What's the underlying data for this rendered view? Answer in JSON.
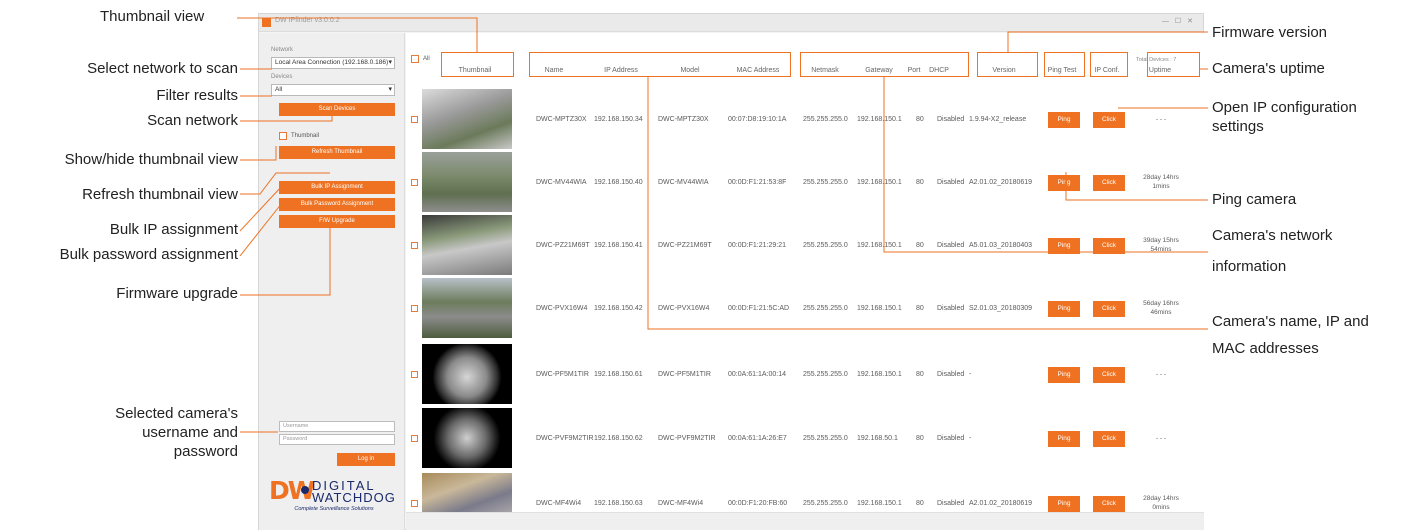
{
  "callouts": {
    "thumbnail_view": "Thumbnail view",
    "select_network": "Select network to scan",
    "filter_results": "Filter results",
    "scan_network": "Scan network",
    "show_hide_thumbnail": "Show/hide thumbnail view",
    "refresh_thumbnail": "Refresh thumbnail view",
    "bulk_ip": "Bulk IP assignment",
    "bulk_password": "Bulk password assignment",
    "firmware_upgrade": "Firmware upgrade",
    "credentials_1": "Selected camera's",
    "credentials_2": "username and",
    "credentials_3": "password",
    "firmware_version": "Firmware version",
    "uptime": "Camera's uptime",
    "open_ip_1": "Open IP configuration",
    "open_ip_2": "settings",
    "ping_camera": "Ping camera",
    "network_info_1": "Camera's network",
    "network_info_2": "information",
    "name_ip_mac_1": "Camera's name, IP and",
    "name_ip_mac_2": "MAC addresses"
  },
  "window": {
    "title": "DW IPfinder v3.0.0.2",
    "controls": "— ☐ ✕"
  },
  "sidebar": {
    "network_label": "Network",
    "network_value": "Local Area Connection (192.168.0.186)",
    "devices_label": "Devices",
    "devices_value": "All",
    "scan_button": "Scan Devices",
    "thumbnail_checkbox": "Thumbnail",
    "refresh_button": "Refresh Thumbnail",
    "bulk_ip_button": "Bulk IP Assignment",
    "bulk_password_button": "Bulk Password Assignment",
    "firmware_button": "F/W Upgrade",
    "username_placeholder": "Username",
    "password_placeholder": "Password",
    "login_button": "Log in"
  },
  "logo": {
    "mark": "DW",
    "brand_line1": "DIGITAL",
    "brand_line2": "WATCHDOG",
    "tagline": "Complete Surveillance Solutions"
  },
  "table": {
    "select_all": "All",
    "total_devices": "Total Devices : 7",
    "headers": {
      "thumbnail": "Thumbnail",
      "name": "Name",
      "ip": "IP Address",
      "model": "Model",
      "mac": "MAC Address",
      "netmask": "Netmask",
      "gateway": "Gateway",
      "port": "Port",
      "dhcp": "DHCP",
      "version": "Version",
      "ping": "Ping Test",
      "ipconf": "IP Conf.",
      "uptime": "Uptime"
    },
    "ping_label": "Ping",
    "click_label": "Click",
    "rows": [
      {
        "name": "DWC-MPTZ30X",
        "ip": "192.168.150.34",
        "model": "DWC-MPTZ30X",
        "mac": "00:07:D8:19:10:1A",
        "netmask": "255.255.255.0",
        "gateway": "192.168.150.1",
        "port": "80",
        "dhcp": "Disabled",
        "version": "1.9.94-X2_release",
        "uptime1": "- - -",
        "uptime2": ""
      },
      {
        "name": "DWC-MV44WIA",
        "ip": "192.168.150.40",
        "model": "DWC-MV44WIA",
        "mac": "00:0D:F1:21:53:8F",
        "netmask": "255.255.255.0",
        "gateway": "192.168.150.1",
        "port": "80",
        "dhcp": "Disabled",
        "version": "A2.01.02_20180619",
        "uptime1": "28day 14hrs",
        "uptime2": "1mins"
      },
      {
        "name": "DWC-PZ21M69T",
        "ip": "192.168.150.41",
        "model": "DWC-PZ21M69T",
        "mac": "00:0D:F1:21:29:21",
        "netmask": "255.255.255.0",
        "gateway": "192.168.150.1",
        "port": "80",
        "dhcp": "Disabled",
        "version": "A5.01.03_20180403",
        "uptime1": "39day 15hrs",
        "uptime2": "54mins"
      },
      {
        "name": "DWC-PVX16W4",
        "ip": "192.168.150.42",
        "model": "DWC-PVX16W4",
        "mac": "00:0D:F1:21:5C:AD",
        "netmask": "255.255.255.0",
        "gateway": "192.168.150.1",
        "port": "80",
        "dhcp": "Disabled",
        "version": "S2.01.03_20180309",
        "uptime1": "56day 16hrs",
        "uptime2": "46mins"
      },
      {
        "name": "DWC-PF5M1TIR",
        "ip": "192.168.150.61",
        "model": "DWC-PF5M1TIR",
        "mac": "00:0A:61:1A:00:14",
        "netmask": "255.255.255.0",
        "gateway": "192.168.150.1",
        "port": "80",
        "dhcp": "Disabled",
        "version": "-",
        "uptime1": "- - -",
        "uptime2": ""
      },
      {
        "name": "DWC-PVF9M2TIR",
        "ip": "192.168.150.62",
        "model": "DWC-PVF9M2TIR",
        "mac": "00:0A:61:1A:26:E7",
        "netmask": "255.255.255.0",
        "gateway": "192.168.50.1",
        "port": "80",
        "dhcp": "Disabled",
        "version": "-",
        "uptime1": "- - -",
        "uptime2": ""
      },
      {
        "name": "DWC-MF4Wi4",
        "ip": "192.168.150.63",
        "model": "DWC-MF4Wi4",
        "mac": "00:0D:F1:20:FB:60",
        "netmask": "255.255.255.0",
        "gateway": "192.168.150.1",
        "port": "80",
        "dhcp": "Disabled",
        "version": "A2.01.02_20180619",
        "uptime1": "28day 14hrs",
        "uptime2": "0mins"
      }
    ]
  },
  "colors": {
    "accent": "#ee7222",
    "logo_blue": "#1a2a6c"
  }
}
